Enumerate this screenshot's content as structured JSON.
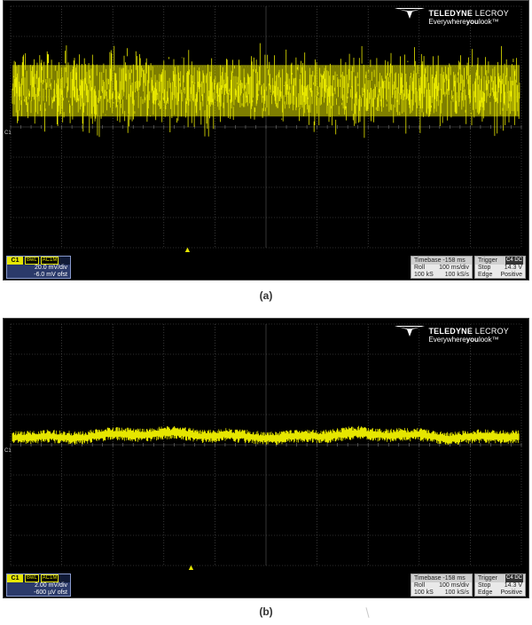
{
  "figures": [
    {
      "brand": {
        "name_bold": "TELEDYNE",
        "name_thin": " LECROY",
        "tag_pre": "Everywhere",
        "tag_bold": "you",
        "tag_post": "look™"
      },
      "channel": {
        "label": "C1",
        "bw_tag": "BwL",
        "coupling_tag": "AC1M",
        "vdiv": "20.0 mV/div",
        "offset": "-6.0 mV ofst",
        "marker": "C1"
      },
      "timebase": {
        "header": "Timebase -158 ms",
        "mode": "Roll",
        "tdiv": "100 ms/div",
        "samples": "100 kS",
        "rate": "100 kS/s"
      },
      "trigger": {
        "header": "Trigger",
        "source": "C4 DC",
        "state": "Stop",
        "level": "14.3 V",
        "type": "Edge",
        "slope": "Positive"
      },
      "trace": {
        "color": "#e6e600",
        "kind": "noise",
        "center_div": 1.2,
        "peak_div": 1.55
      },
      "caption": "(a)"
    },
    {
      "brand": {
        "name_bold": "TELEDYNE",
        "name_thin": " LECROY",
        "tag_pre": "Everywhere",
        "tag_bold": "you",
        "tag_post": "look™"
      },
      "channel": {
        "label": "C1",
        "bw_tag": "BwL",
        "coupling_tag": "AC1M",
        "vdiv": "2.00 mV/div",
        "offset": "-600 µV ofst",
        "marker": "C1"
      },
      "timebase": {
        "header": "Timebase -158 ms",
        "mode": "Roll",
        "tdiv": "100 ms/div",
        "samples": "100 kS",
        "rate": "100 kS/s"
      },
      "trigger": {
        "header": "Trigger",
        "source": "C4 DC",
        "state": "Stop",
        "level": "14.3 V",
        "type": "Edge",
        "slope": "Positive"
      },
      "trace": {
        "color": "#e6e600",
        "kind": "low-noise",
        "center_div": 0.3,
        "peak_div": 0.15
      },
      "caption": "(b)"
    }
  ]
}
